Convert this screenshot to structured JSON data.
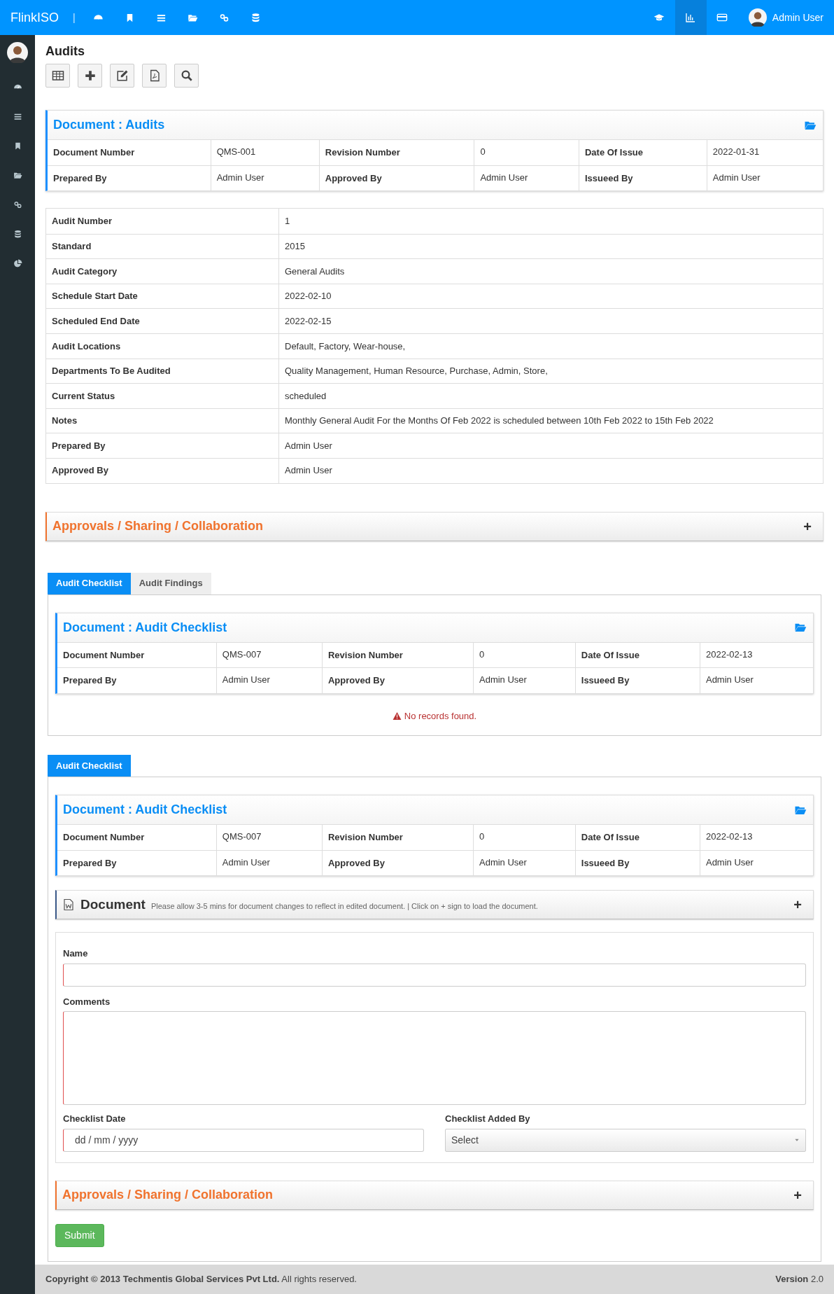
{
  "top_nav": {
    "brand": "FlinkISO",
    "separator": "|",
    "right_icons": [
      {
        "selected": false
      },
      {
        "selected": true
      },
      {
        "selected": false
      }
    ],
    "user": "Admin User"
  },
  "page_title": "Audits",
  "document_card": {
    "title": "Document : Audits",
    "rows": [
      [
        {
          "label": "Document Number",
          "value": "QMS-001"
        },
        {
          "label": "Revision Number",
          "value": "0"
        },
        {
          "label": "Date Of Issue",
          "value": "2022-01-31"
        }
      ],
      [
        {
          "label": "Prepared By",
          "value": "Admin User"
        },
        {
          "label": "Approved By",
          "value": "Admin User"
        },
        {
          "label": "Issueed By",
          "value": "Admin User"
        }
      ]
    ]
  },
  "details": [
    {
      "label": "Audit Number",
      "value": "1"
    },
    {
      "label": "Standard",
      "value": "2015"
    },
    {
      "label": "Audit Category",
      "value": "General Audits"
    },
    {
      "label": "Schedule Start Date",
      "value": "2022-02-10"
    },
    {
      "label": "Scheduled End Date",
      "value": "2022-02-15"
    },
    {
      "label": "Audit Locations",
      "value": "Default, Factory, Wear-house,"
    },
    {
      "label": "Departments To Be Audited",
      "value": "Quality Management, Human Resource, Purchase, Admin, Store,"
    },
    {
      "label": "Current Status",
      "value": "scheduled"
    },
    {
      "label": "Notes",
      "value": "Monthly General Audit For the Months Of Feb 2022 is scheduled between 10th Feb 2022 to 15th Feb 2022"
    },
    {
      "label": "Prepared By",
      "value": "Admin User"
    },
    {
      "label": "Approved By",
      "value": "Admin User"
    }
  ],
  "approvals": {
    "title": "Approvals / Sharing / Collaboration",
    "toggle": "+"
  },
  "tabs_1": {
    "tabs": [
      {
        "label": "Audit Checklist",
        "selected": true
      },
      {
        "label": "Audit Findings",
        "selected": false
      }
    ],
    "document_card": {
      "title": "Document : Audit Checklist",
      "rows": [
        [
          {
            "label": "Document Number",
            "value": "QMS-007"
          },
          {
            "label": "Revision Number",
            "value": "0"
          },
          {
            "label": "Date Of Issue",
            "value": "2022-02-13"
          }
        ],
        [
          {
            "label": "Prepared By",
            "value": "Admin User"
          },
          {
            "label": "Approved By",
            "value": "Admin User"
          },
          {
            "label": "Issueed By",
            "value": "Admin User"
          }
        ]
      ]
    },
    "message": "No records found."
  },
  "tabs_2": {
    "tabs": [
      {
        "label": "Audit Checklist",
        "selected": true
      }
    ],
    "document_card": {
      "title": "Document : Audit Checklist",
      "rows": [
        [
          {
            "label": "Document Number",
            "value": "QMS-007"
          },
          {
            "label": "Revision Number",
            "value": "0"
          },
          {
            "label": "Date Of Issue",
            "value": "2022-02-13"
          }
        ],
        [
          {
            "label": "Prepared By",
            "value": "Admin User"
          },
          {
            "label": "Approved By",
            "value": "Admin User"
          },
          {
            "label": "Issueed By",
            "value": "Admin User"
          }
        ]
      ]
    },
    "document_bar": {
      "title": "Document",
      "note": "Please allow 3-5 mins for document changes to reflect in edited document. | Click on + sign to load the document.",
      "toggle": "+"
    },
    "form": {
      "name_label": "Name",
      "comments_label": "Comments",
      "date_label": "Checklist Date",
      "date_placeholder": "dd / mm / yyyy",
      "added_by_label": "Checklist Added By",
      "added_by_value": "Select"
    },
    "approvals": {
      "title": "Approvals / Sharing / Collaboration",
      "toggle": "+"
    },
    "submit": "Submit"
  },
  "footer": {
    "copyright": "**Copyright © 2013 Techmentis Global Services Pvt Ltd.** All rights reserved.",
    "version": "**Version** 2.0"
  }
}
